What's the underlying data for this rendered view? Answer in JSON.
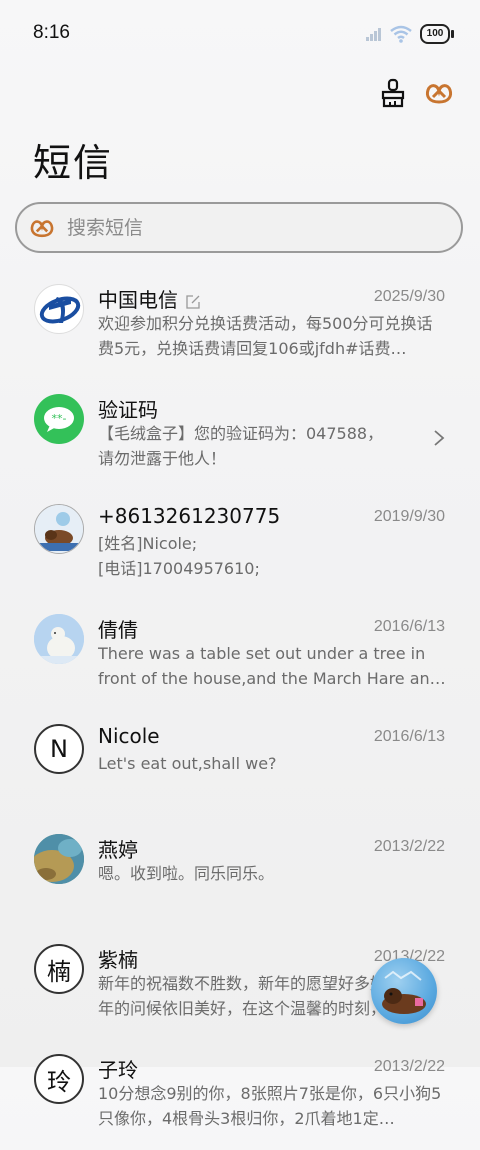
{
  "status": {
    "time": "8:16",
    "battery": "100"
  },
  "page": {
    "title": "短信"
  },
  "search": {
    "placeholder": "搜索短信"
  },
  "messages": [
    {
      "name": "中国电信",
      "date": "2025/9/30",
      "preview": "欢迎参加积分兑换话费活动，每500分可兑换话费5元，兑换话费请回复106或jfdh#话费…",
      "avatar": "telecom-logo-avatar",
      "has_edit_mark": true
    },
    {
      "name": "验证码",
      "date": "",
      "preview": "【毛绒盒子】您的验证码为：047588，\n请勿泄露于他人！",
      "avatar": "sms-bubble-avatar"
    },
    {
      "name": "+8613261230775",
      "date": "2019/9/30",
      "preview": "[姓名]Nicole;\n[电话]17004957610;",
      "avatar": "dog-photo-avatar"
    },
    {
      "name": "倩倩",
      "date": "2016/6/13",
      "preview": "There was a table set out under a tree in front of the house,and the March Hare an…",
      "avatar": "polar-bear-avatar"
    },
    {
      "name": "Nicole",
      "date": "2016/6/13",
      "preview": "Let's eat out,shall we?",
      "avatar_letter": "N"
    },
    {
      "name": "燕婷",
      "date": "2013/2/22",
      "preview": "嗯。收到啦。同乐同乐。",
      "avatar": "landscape-avatar"
    },
    {
      "name": "紫楠",
      "date": "2013/2/22",
      "preview": "新年的祝福数不胜数，新年的愿望好多好多，新年的问候依旧美好，在这个温馨的时刻，…",
      "avatar_letter": "楠"
    },
    {
      "name": "子玲",
      "date": "2013/2/22",
      "preview": "10分想念9别的你，8张照片7张是你，6只小狗5只像你，4根骨头3根归你，2爪着地1定…",
      "avatar_letter": "玲"
    }
  ],
  "colors": {
    "accent_brown": "#b8651b",
    "sms_green": "#33c159",
    "telecom_blue": "#1a4ea1"
  }
}
